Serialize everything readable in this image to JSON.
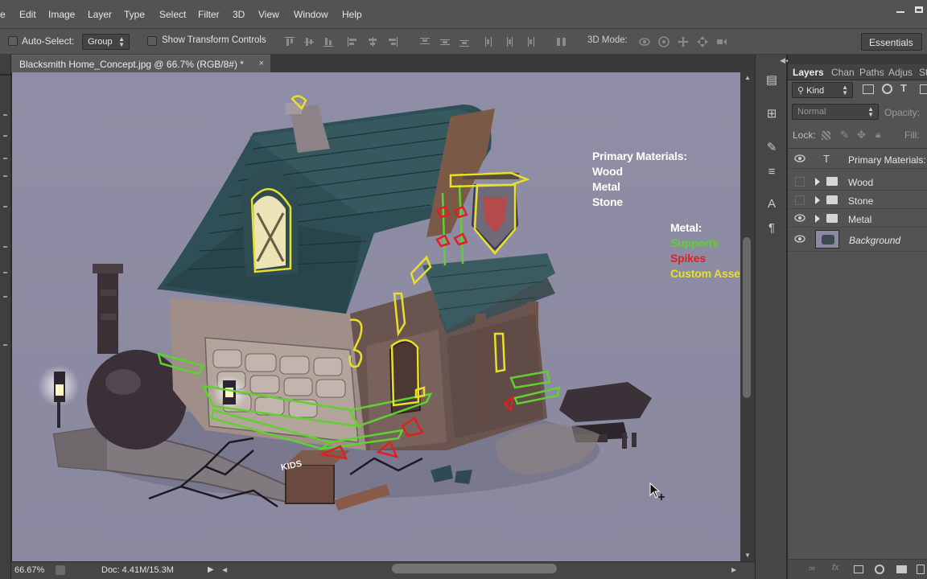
{
  "menubar": {
    "items": [
      "e",
      "Edit",
      "Image",
      "Layer",
      "Type",
      "Select",
      "Filter",
      "3D",
      "View",
      "Window",
      "Help"
    ]
  },
  "options": {
    "auto_select_label": "Auto-Select:",
    "auto_select_value": "Group",
    "show_transform_label": "Show Transform Controls",
    "mode_3d_label": "3D Mode:",
    "workspace": "Essentials"
  },
  "document": {
    "tab_title": "Blacksmith Home_Concept.jpg @ 66.7% (RGB/8#) *",
    "close_glyph": "×"
  },
  "canvas_text": {
    "primary_title": "Primary Materials:",
    "primary_items": [
      "Wood",
      "Metal",
      "Stone"
    ],
    "metal_title": "Metal:",
    "metal_items": [
      {
        "label": "Supports",
        "color": "#5fd12e"
      },
      {
        "label": "Spikes",
        "color": "#e02020"
      },
      {
        "label": "Custom Asset",
        "color": "#e7e02a"
      }
    ]
  },
  "status": {
    "zoom": "66.67%",
    "doc_size": "Doc: 4.41M/15.3M"
  },
  "layers_panel": {
    "tabs": [
      "Layers",
      "Chan",
      "Paths",
      "Adjus",
      "St"
    ],
    "filter_kind": "Kind",
    "blend_mode": "Normal",
    "opacity_label": "Opacity:",
    "lock_label": "Lock:",
    "fill_label": "Fill:",
    "layers": [
      {
        "name": "Primary Materials: W",
        "type": "text",
        "visible": true
      },
      {
        "name": "Wood",
        "type": "group",
        "visible": false
      },
      {
        "name": "Stone",
        "type": "group",
        "visible": false
      },
      {
        "name": "Metal",
        "type": "group",
        "visible": true
      },
      {
        "name": "Background",
        "type": "image",
        "visible": true
      }
    ]
  },
  "colors": {
    "ui_bg": "#535353",
    "canvas_bg": "#8a89a0",
    "supports": "#5fd12e",
    "spikes": "#e02020",
    "custom": "#e7e02a"
  }
}
